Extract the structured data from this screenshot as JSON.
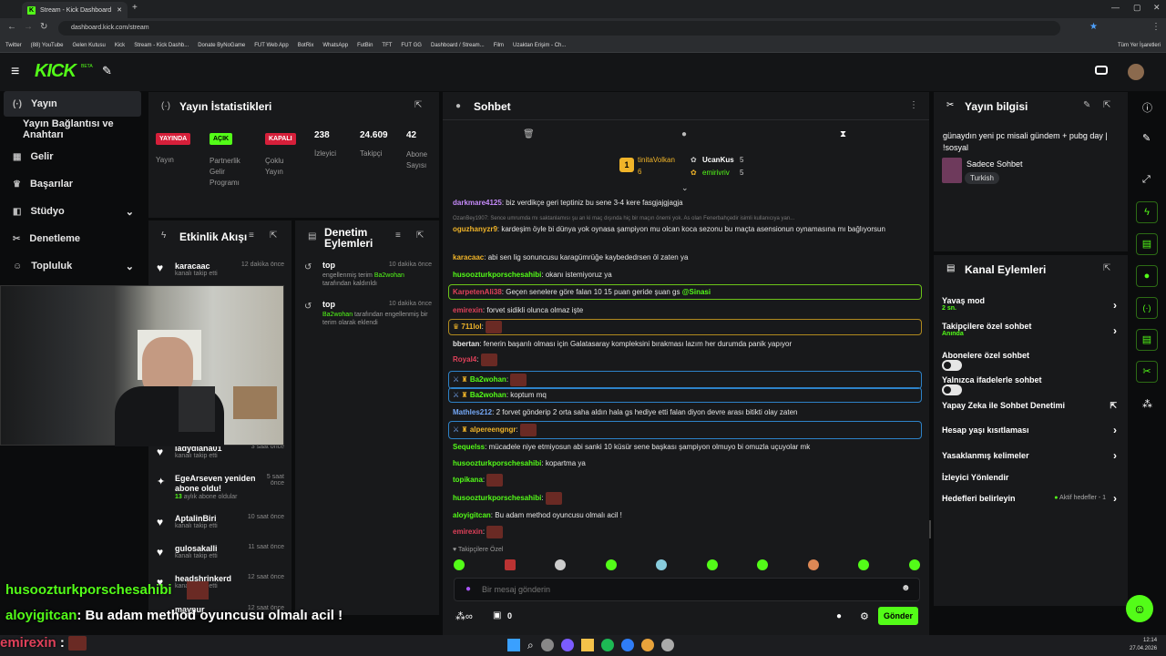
{
  "browser": {
    "tab_title": "Stream - Kick Dashboard",
    "url": "dashboard.kick.com/stream",
    "bookmarks": [
      "Twitter",
      "(88) YouTube",
      "Gelen Kutusu",
      "Kick",
      "Stream - Kick Dashb...",
      "Donate ByNoGame",
      "FUT Web App",
      "BotRix",
      "WhatsApp",
      "FutBin",
      "TFT",
      "FUT GG",
      "Dashboard / Stream...",
      "Film",
      "Uzaktan Erişim - Ch..."
    ],
    "bookmarks_right": "Tüm Yer İşaretleri"
  },
  "header": {
    "logo": "KICK",
    "beta": "BETA"
  },
  "sidebar": {
    "items": [
      {
        "label": "Yayın",
        "icon": "broadcast-icon"
      },
      {
        "label": "Yayın Bağlantısı ve Anahtarı",
        "icon": ""
      },
      {
        "label": "Gelir",
        "icon": "chart-icon"
      },
      {
        "label": "Başarılar",
        "icon": "trophy-icon"
      },
      {
        "label": "Stüdyo",
        "icon": "studio-icon"
      },
      {
        "label": "Denetleme",
        "icon": "wrench-icon"
      },
      {
        "label": "Topluluk",
        "icon": "community-icon"
      }
    ]
  },
  "stats": {
    "title": "Yayın İstatistikleri",
    "cols": [
      {
        "badge": "YAYINDA",
        "label": "Yayın"
      },
      {
        "badge": "AÇIK",
        "label": "Partnerlik Gelir Programı"
      },
      {
        "badge": "KAPALI",
        "label": "Çoklu Yayın"
      },
      {
        "value": "238",
        "label": "İzleyici"
      },
      {
        "value": "24.609",
        "label": "Takipçi"
      },
      {
        "value": "42",
        "label": "Abone Sayısı"
      }
    ]
  },
  "activity": {
    "title": "Etkinlik Akışı",
    "items": [
      {
        "name": "karacaac",
        "sub": "kanalı takip etti",
        "time": "12 dakika önce"
      },
      {
        "name": "ladydiana01",
        "sub": "kanalı takip etti",
        "time": "3 saat önce"
      },
      {
        "name": "EgeArseven yeniden abone oldu!",
        "sub": "aylık abone oldular",
        "months": "13",
        "time": "5 saat önce"
      },
      {
        "name": "AptalinBiri",
        "sub": "kanalı takip etti",
        "time": "10 saat önce"
      },
      {
        "name": "gulosakalli",
        "sub": "kanalı takip etti",
        "time": "11 saat önce"
      },
      {
        "name": "headshrinkerd",
        "sub": "kanalı takip etti",
        "time": "12 saat önce"
      },
      {
        "name": "maynur",
        "sub": "",
        "time": "12 saat önce"
      }
    ]
  },
  "moderation": {
    "title": "Denetim Eylemleri",
    "items": [
      {
        "user": "top",
        "time": "10 dakika önce",
        "pre": "engellenmiş terim",
        "target": "Ba2wohan",
        "post": "tarafından kaldırıldı"
      },
      {
        "user": "top",
        "time": "10 dakika önce",
        "pre": "",
        "target": "Ba2wohan",
        "post": "tarafından engellenmiş bir terim olarak eklendi"
      }
    ]
  },
  "chat": {
    "title": "Sohbet",
    "top_gifters": [
      {
        "name": "tinitaVolkan",
        "count": "6"
      },
      {
        "name": "UcanKus",
        "count": "5"
      },
      {
        "name": "emirivriv",
        "count": "5"
      }
    ],
    "reply_preview": "OzanBey1907: Sence umrumda mı saktanlamısı şu an ki maç dışında hiç bir maçın önemi yok. As olan Fenerbahçedir isimli kullanıcıya yan...",
    "messages": [
      {
        "user": "darkmare4125",
        "color": "#c58af9",
        "text": "biz verdikçe geri teptiniz bu sene 3-4 kere fasgjajgjagja"
      },
      {
        "user": "oguzhanyzr9",
        "color": "#f0b429",
        "text": "kardeşim öyle bi dünya yok oynasa şampiyon mu olcan koca sezonu bu maçta asensionun oynamasına mı bağlıyorsun"
      },
      {
        "user": "karacaac",
        "color": "#f0b429",
        "text": "abi sen lig sonuncusu karagümrüğe kaybededrsen öl zaten ya"
      },
      {
        "user": "husoozturkporschesahibi",
        "color": "#53fc18",
        "text": "okanı istemiyoruz ya"
      },
      {
        "user": "KarpetenAli38",
        "color": "#e0415a",
        "text": "Geçen senelere göre falan 10 15 puan geride şuan gs",
        "mention": "@Sinasi"
      },
      {
        "user": "emirexin",
        "color": "#e0415a",
        "text": "forvet sidikli olunca olmaz işte"
      },
      {
        "user": "711lol",
        "color": "#f0b429",
        "text": ""
      },
      {
        "user": "bbertan",
        "color": "#e6e6e6",
        "text": "fenerin başarılı olması için Galatasaray kompleksini bırakması lazım her durumda panik yapıyor"
      },
      {
        "user": "Royal4",
        "color": "#e0415a",
        "text": ""
      },
      {
        "user": "Ba2wohan",
        "color": "#53fc18",
        "text": ""
      },
      {
        "user": "Ba2wohan",
        "color": "#53fc18",
        "text": "koptum mq"
      },
      {
        "user": "Mathles212",
        "color": "#74a7f5",
        "text": "2 forvet gönderip 2 orta saha aldın hala gs hediye etti falan diyon devre arası bitikti olay zaten"
      },
      {
        "user": "alpereengngr",
        "color": "#f0b429",
        "text": ""
      },
      {
        "user": "Sequelss",
        "color": "#53fc18",
        "text": "mücadele niye etmiyosun abi sanki 10 küsür sene başkası şampiyon olmuyo bi omuzla uçuyolar mk"
      },
      {
        "user": "husoozturkporschesahibi",
        "color": "#53fc18",
        "text": "kopartma ya"
      },
      {
        "user": "topikana",
        "color": "#53fc18",
        "text": ""
      },
      {
        "user": "husoozturkporschesahibi",
        "color": "#53fc18",
        "text": ""
      },
      {
        "user": "aloyigitcan",
        "color": "#53fc18",
        "text": "Bu adam method oyuncusu olmalı acil !"
      },
      {
        "user": "emirexin",
        "color": "#e0415a",
        "text": ""
      }
    ],
    "followers_only": "Takipçilere Özel",
    "input_placeholder": "Bir mesaj gönderin",
    "viewer_count": "0",
    "send_label": "Gönder"
  },
  "stream_info": {
    "title": "Yayın bilgisi",
    "stream_title": "günaydın yeni pc misali gündem + pubg day | !sosyal",
    "category": "Sadece Sohbet",
    "tag": "Turkish"
  },
  "channel_actions": {
    "title": "Kanal Eylemleri",
    "items": [
      {
        "label": "Yavaş mod",
        "sub": "2 sn.",
        "type": "chevron"
      },
      {
        "label": "Takipçilere özel sohbet",
        "sub": "Anında",
        "type": "chevron"
      },
      {
        "label": "Abonelere özel sohbet",
        "sub": "",
        "type": "toggle"
      },
      {
        "label": "Yalnızca ifadelerle sohbet",
        "sub": "",
        "type": "toggle"
      },
      {
        "label": "Yapay Zeka ile Sohbet Denetimi",
        "sub": "",
        "type": "external"
      },
      {
        "label": "Hesap yaşı kısıtlaması",
        "sub": "",
        "type": "chevron"
      },
      {
        "label": "Yasaklanmış kelimeler",
        "sub": "",
        "type": "chevron"
      },
      {
        "label": "İzleyici Yönlendir",
        "sub": "",
        "type": "none"
      },
      {
        "label": "Hedefleri belirleyin",
        "sub": "",
        "type": "chevron",
        "extra": "Aktif hedefler - 1"
      }
    ]
  },
  "overlay": {
    "line1_user": "husoozturkporschesahibi",
    "line2_user": "aloyigitcan",
    "line2_text": ": Bu adam method oyuncusu olmalı acil !",
    "line3_user": "emirexin"
  },
  "taskbar": {
    "time": "12:14",
    "date": "27.04.2026"
  },
  "colors": {
    "accent": "#53fc18",
    "panel": "#18191b",
    "bg": "#0b0c0d"
  }
}
